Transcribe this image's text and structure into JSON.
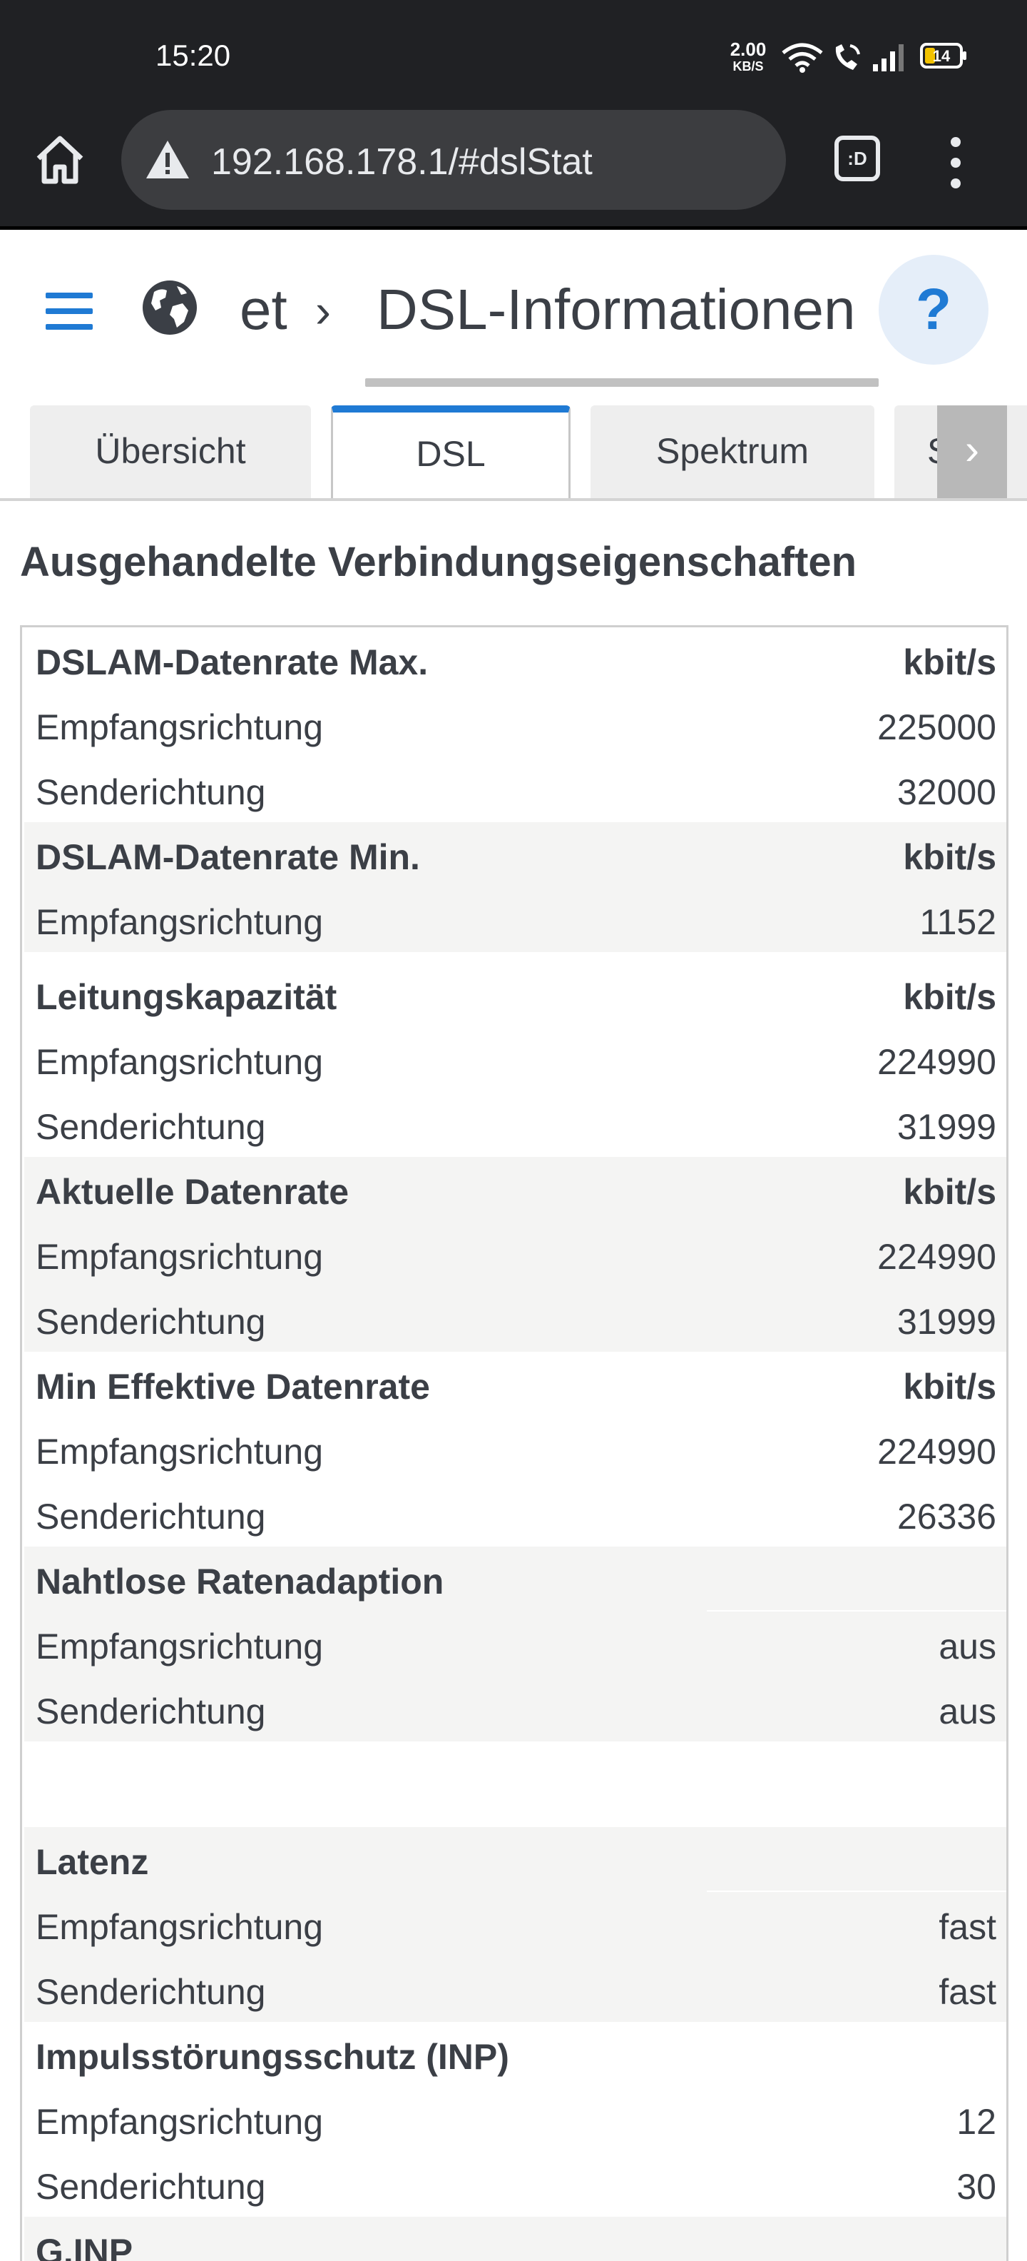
{
  "status_bar": {
    "time": "15:20",
    "net_speed_value": "2.00",
    "net_speed_unit": "KB/S",
    "battery": "14",
    "icons": [
      "wifi-icon",
      "wifi-calling-icon",
      "signal-icon",
      "battery-icon"
    ]
  },
  "browser": {
    "url": "192.168.178.1/#dslStat",
    "tabs_button_label": ":D",
    "icons": [
      "home-icon",
      "warning-icon",
      "overflow-menu-icon"
    ]
  },
  "header": {
    "breadcrumb_root": "et",
    "breadcrumb_separator": "›",
    "title": "DSL-Informationen",
    "help_label": "?",
    "icons": [
      "hamburger-menu-icon",
      "globe-icon"
    ],
    "accent_color": "#1f7ad4"
  },
  "tabs": [
    {
      "label": "Übersicht",
      "active": false
    },
    {
      "label": "DSL",
      "active": true
    },
    {
      "label": "Spektrum",
      "active": false
    },
    {
      "label": "Sta",
      "active": false
    }
  ],
  "tab_next_label": "›",
  "section": {
    "title": "Ausgehandelte Verbindungseigenschaften",
    "rows": [
      {
        "label": "DSLAM-Datenrate Max.",
        "value": "kbit/s"
      },
      {
        "label": "Empfangsrichtung",
        "value": "225000"
      },
      {
        "label": "Senderichtung",
        "value": "32000"
      },
      {
        "label": "DSLAM-Datenrate Min.",
        "value": "kbit/s"
      },
      {
        "label": "Empfangsrichtung",
        "value": "1152"
      },
      {
        "label": "Leitungskapazität",
        "value": "kbit/s"
      },
      {
        "label": "Empfangsrichtung",
        "value": "224990"
      },
      {
        "label": "Senderichtung",
        "value": "31999"
      },
      {
        "label": "Aktuelle Datenrate",
        "value": "kbit/s"
      },
      {
        "label": "Empfangsrichtung",
        "value": "224990"
      },
      {
        "label": "Senderichtung",
        "value": "31999"
      },
      {
        "label": "Min Effektive Datenrate",
        "value": "kbit/s"
      },
      {
        "label": "Empfangsrichtung",
        "value": "224990"
      },
      {
        "label": "Senderichtung",
        "value": "26336"
      },
      {
        "label": "Nahtlose Ratenadaption",
        "value": ""
      },
      {
        "label": "Empfangsrichtung",
        "value": "aus"
      },
      {
        "label": "Senderichtung",
        "value": "aus"
      },
      {
        "label": "",
        "value": ""
      },
      {
        "label": "Latenz",
        "value": ""
      },
      {
        "label": "Empfangsrichtung",
        "value": "fast"
      },
      {
        "label": "Senderichtung",
        "value": "fast"
      },
      {
        "label": "Impulsstörungsschutz (INP)",
        "value": ""
      },
      {
        "label": "Empfangsrichtung",
        "value": "12"
      },
      {
        "label": "Senderichtung",
        "value": "30"
      },
      {
        "label": "G.INP",
        "value": ""
      }
    ]
  }
}
